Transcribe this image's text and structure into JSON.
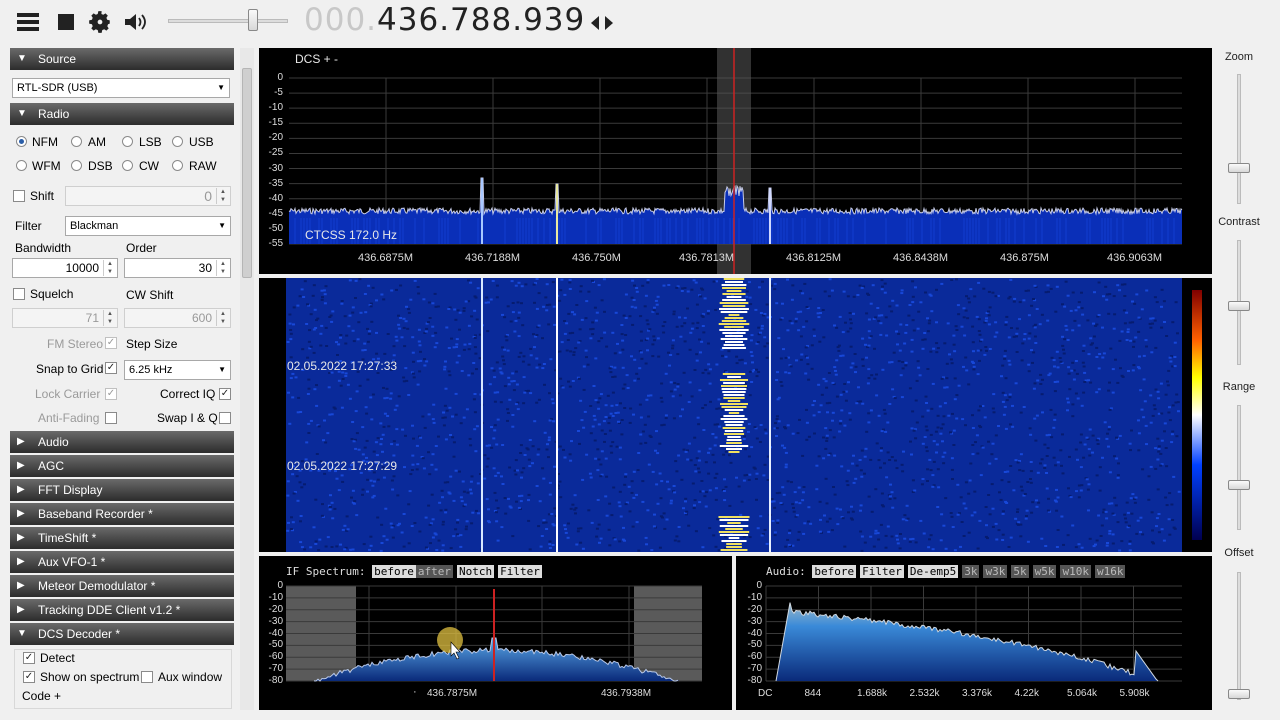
{
  "toolbar": {
    "menu_icon": "hamburger-icon",
    "stop_icon": "stop-icon",
    "settings_icon": "gear-icon",
    "volume_icon": "speaker-icon",
    "volume_level": 0.72,
    "freq_prefix": "000.",
    "freq_main": "436.788.939",
    "tune_icon": "left-right-arrows-icon"
  },
  "source": {
    "header": "Source",
    "device": "RTL-SDR (USB)"
  },
  "radio": {
    "header": "Radio",
    "modes": [
      "NFM",
      "AM",
      "LSB",
      "USB",
      "WFM",
      "DSB",
      "CW",
      "RAW"
    ],
    "selected_mode": "NFM",
    "shift_label": "Shift",
    "shift_value": "0",
    "filter_label": "Filter",
    "filter_value": "Blackman",
    "bandwidth_label": "Bandwidth",
    "bandwidth_value": "10000",
    "order_label": "Order",
    "order_value": "30",
    "squelch_label": "Squelch",
    "squelch_value": "71",
    "cw_shift_label": "CW Shift",
    "cw_shift_value": "600",
    "fm_stereo_label": "FM Stereo",
    "step_size_label": "Step Size",
    "snap_label": "Snap to Grid",
    "step_value": "6.25 kHz",
    "lock_carrier_label": "Lock Carrier",
    "correct_iq_label": "Correct IQ",
    "anti_fading_label": "Anti-Fading",
    "swap_iq_label": "Swap I & Q"
  },
  "sections": [
    "Audio",
    "AGC",
    "FFT Display",
    "Baseband Recorder *",
    "TimeShift *",
    "Aux VFO-1 *",
    "Meteor Demodulator *",
    "Tracking DDE Client v1.2 *",
    "DCS Decoder *"
  ],
  "dcs": {
    "detect_label": "Detect",
    "show_label": "Show on spectrum",
    "aux_label": "Aux window",
    "code_label": "Code +"
  },
  "spectrum": {
    "dcs_label": "DCS +  -",
    "ctcss_label": "CTCSS  172.0 Hz",
    "y_ticks": [
      "0",
      "-5",
      "-10",
      "-15",
      "-20",
      "-25",
      "-30",
      "-35",
      "-40",
      "-45",
      "-50",
      "-55"
    ],
    "x_ticks": [
      "436.6875M",
      "436.7188M",
      "436.750M",
      "436.7813M",
      "436.8125M",
      "436.8438M",
      "436.875M",
      "436.9063M"
    ]
  },
  "waterfall": {
    "timestamps": [
      "02.05.2022 17:27:33",
      "02.05.2022 17:27:29"
    ]
  },
  "if_spectrum": {
    "title": "IF Spectrum:",
    "buttons": [
      "before",
      "after",
      "Notch",
      "Filter"
    ],
    "y_ticks": [
      "0",
      "-10",
      "-20",
      "-30",
      "-40",
      "-50",
      "-60",
      "-70",
      "-80"
    ],
    "x_ticks": [
      "436.7875M",
      "436.7938M"
    ]
  },
  "audio_spectrum": {
    "title": "Audio:",
    "buttons": [
      "before",
      "Filter",
      "De-emp5",
      "3k",
      "w3k",
      "5k",
      "w5k",
      "w10k",
      "w16k"
    ],
    "y_ticks": [
      "0",
      "-10",
      "-20",
      "-30",
      "-40",
      "-50",
      "-60",
      "-70",
      "-80"
    ],
    "x_ticks": [
      "DC",
      "844",
      "1.688k",
      "2.532k",
      "3.376k",
      "4.22k",
      "5.064k",
      "5.908k"
    ]
  },
  "right_sliders": {
    "zoom_label": "Zoom",
    "contrast_label": "Contrast",
    "range_label": "Range",
    "offset_label": "Offset"
  },
  "colors": {
    "panel_bg": "#000000",
    "spectrum_fill": "#0a2fb8",
    "vfo_line": "#cc2222",
    "section_header": "#3a3a3a"
  }
}
